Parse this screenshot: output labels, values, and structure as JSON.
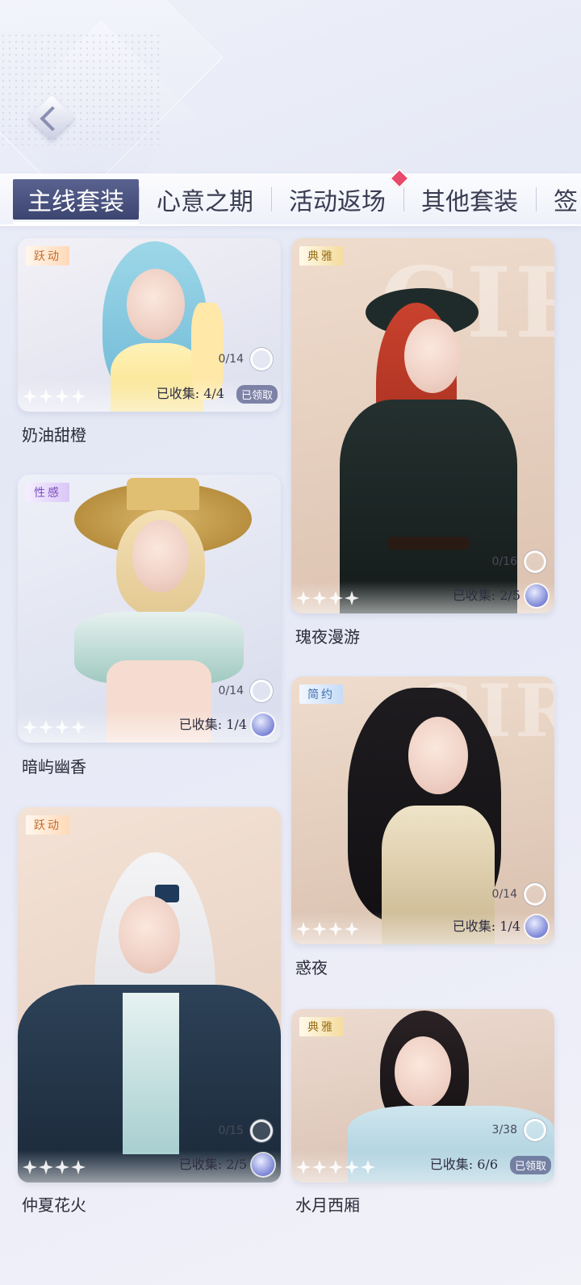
{
  "header": {
    "back_icon": "back-arrow-icon"
  },
  "tabs": [
    {
      "label": "主线套装",
      "active": true
    },
    {
      "label": "心意之期"
    },
    {
      "label": "活动返场",
      "badge": true
    },
    {
      "label": "其他套装"
    },
    {
      "label": "签"
    }
  ],
  "cards": [
    {
      "tag": "跃动",
      "progress": "0/14",
      "collected": "已收集: 4/4",
      "claim": "已领取",
      "title": "奶油甜橙"
    },
    {
      "tag": "典雅",
      "progress": "0/16",
      "collected": "已收集: 2/5",
      "title": "瑰夜漫游"
    },
    {
      "tag": "性感",
      "progress": "0/14",
      "collected": "已收集: 1/4",
      "title": "暗屿幽香"
    },
    {
      "tag": "简约",
      "progress": "0/14",
      "collected": "已收集: 1/4",
      "title": "惑夜"
    },
    {
      "tag": "跃动",
      "progress": "0/15",
      "collected": "已收集: 2/5",
      "title": "仲夏花火"
    },
    {
      "tag": "典雅",
      "progress": "3/38",
      "collected": "已收集: 6/6",
      "claim": "已领取",
      "title": "水月西厢"
    }
  ],
  "colors": {
    "active_tab": "#4a5380",
    "badge_red": "#e74a6a"
  }
}
